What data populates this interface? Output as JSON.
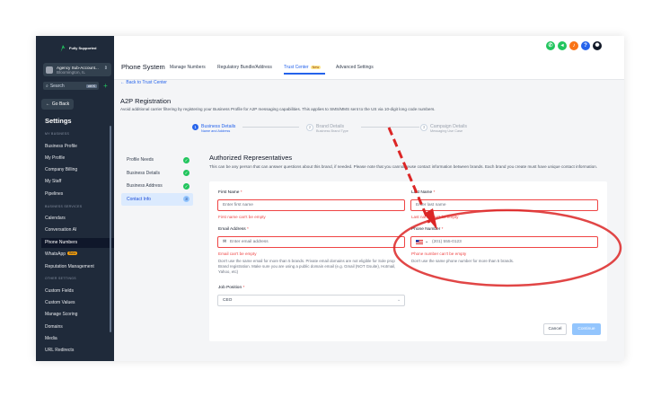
{
  "header": {
    "logo": "Fully Supported",
    "icon_colors": [
      "#22c55e",
      "#22c55e",
      "#f97316",
      "#2563eb"
    ]
  },
  "sidebar": {
    "account_name": "Agency Sub-Account...",
    "account_location": "Bloomington, IL",
    "search_label": "Search",
    "search_shortcut": "ctrl K",
    "go_back": "Go Back",
    "settings_title": "Settings",
    "section_my_business": "MY BUSINESS",
    "section_business_services": "BUSINESS SERVICES",
    "section_other_settings": "OTHER SETTINGS",
    "items": [
      {
        "label": "Business Profile"
      },
      {
        "label": "My Profile"
      },
      {
        "label": "Company Billing"
      },
      {
        "label": "My Staff"
      },
      {
        "label": "Pipelines"
      },
      {
        "label": "Calendars"
      },
      {
        "label": "Conversation AI"
      },
      {
        "label": "Phone Numbers"
      },
      {
        "label": "WhatsApp",
        "badge": "Beta"
      },
      {
        "label": "Reputation Management"
      },
      {
        "label": "Custom Fields"
      },
      {
        "label": "Custom Values"
      },
      {
        "label": "Manage Scoring"
      },
      {
        "label": "Domains"
      },
      {
        "label": "Media"
      },
      {
        "label": "URL Redirects"
      }
    ]
  },
  "topbar": {
    "section": "Phone System",
    "tabs": [
      "Manage Numbers",
      "Regulatory Bundle/Address",
      "Trust Center",
      "Advanced Settings"
    ],
    "new_badge": "New"
  },
  "main": {
    "back_link": "Back to Trust Center",
    "title": "A2P Registration",
    "description": "Avoid additional carrier filtering by registering your Business Profile for A2P messaging capabilities. This applies to SMS/MMS sent to the US via 10-digit long code numbers.",
    "steps": [
      {
        "num": "1",
        "title": "Business Details",
        "sub": "Name and Address"
      },
      {
        "num": "2",
        "title": "Brand Details",
        "sub": "Business Brand Type"
      },
      {
        "num": "3",
        "title": "Campaign Details",
        "sub": "Messaging Use Case"
      }
    ],
    "left_steps": [
      "Profile Needs",
      "Business Details",
      "Business Address",
      "Contact Info"
    ],
    "active_step_num": "3"
  },
  "form": {
    "title": "Authorized Representatives",
    "description": "This can be any person that can answer questions about this brand, if needed. Please note that you cannot reuse contact information between brands. Each brand you create must have unique contact information.",
    "first_name_label": "First Name",
    "first_name_placeholder": "Enter first name",
    "first_name_error": "First name can't be empty",
    "last_name_label": "Last Name",
    "last_name_placeholder": "Enter last name",
    "last_name_error": "Last name can't be empty",
    "email_label": "Email Address",
    "email_placeholder": "Enter email address",
    "email_error": "Email can't be empty",
    "email_help": "Don't use the same email for more than 5 brands. Private email domains are not eligible for Sole prop Brand registration. Make sure you are using a public domain email (e.g. Gmail (NOT Gsuite), Hotmail, Yahoo, etc)",
    "phone_label": "Phone Number",
    "phone_placeholder": "(201) 555-0123",
    "phone_error": "Phone number can't be empty",
    "phone_help": "Don't use the same phone number for more than 5 brands.",
    "job_label": "Job Position",
    "job_value": "CEO",
    "required_mark": "*",
    "cancel": "Cancel",
    "continue": "Continue"
  },
  "annotation": {
    "color": "#dc2626"
  }
}
